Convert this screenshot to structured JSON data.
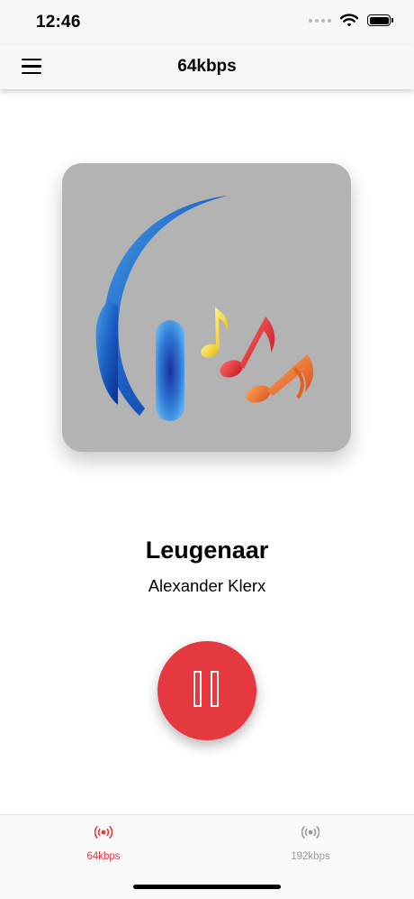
{
  "status_bar": {
    "time": "12:46",
    "signal_icon": "cellular-dots-icon",
    "wifi_icon": "wifi-icon",
    "battery_icon": "battery-full-icon"
  },
  "nav": {
    "title": "64kbps",
    "menu_icon": "hamburger-menu-icon"
  },
  "artwork": {
    "icon": "headphones-music-notes-logo",
    "background": "#b3b3b3"
  },
  "now_playing": {
    "title": "Leugenaar",
    "artist": "Alexander Klerx",
    "state": "playing",
    "control_icon": "pause-icon",
    "accent_color": "#e5383f"
  },
  "tabs": [
    {
      "label": "64kbps",
      "icon": "radio-broadcast-icon",
      "active": true,
      "color": "#e5383f"
    },
    {
      "label": "192kbps",
      "icon": "radio-broadcast-icon",
      "active": false,
      "color": "#9a9a9a"
    }
  ]
}
